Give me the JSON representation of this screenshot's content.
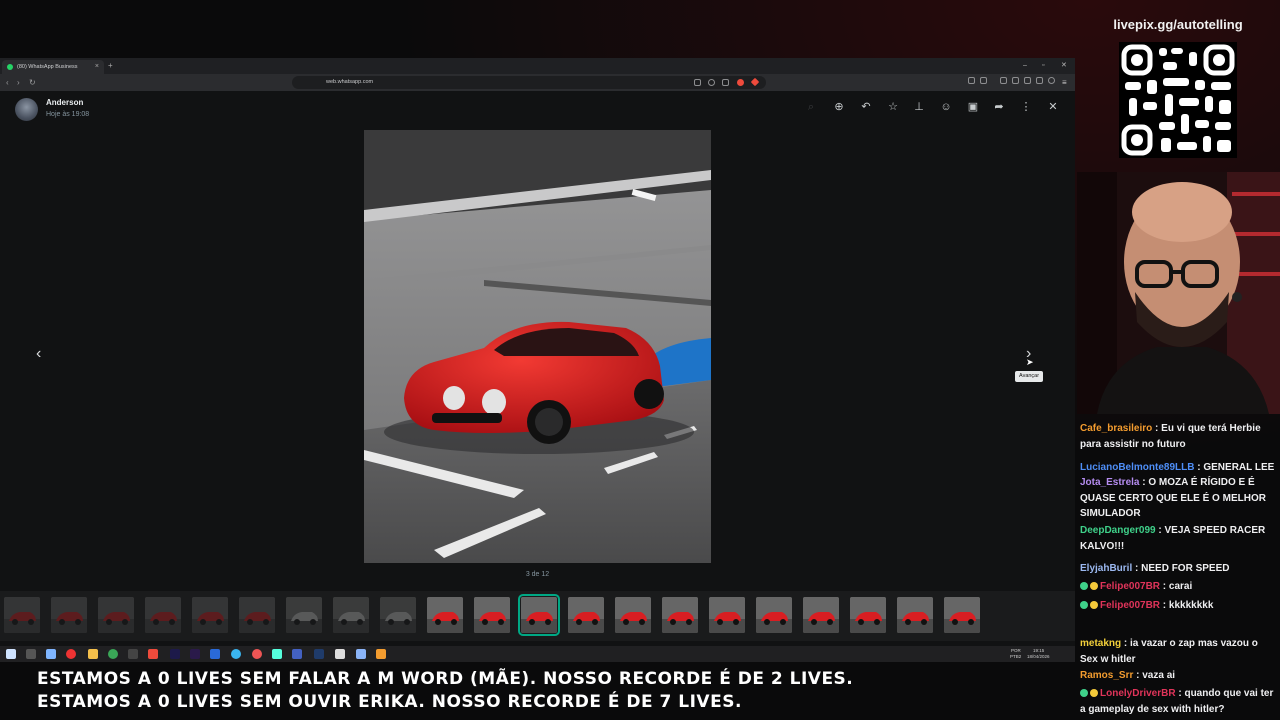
{
  "browser": {
    "tab_title": "(80) WhatsApp Business",
    "url": "web.whatsapp.com"
  },
  "viewer": {
    "sender": "Anderson",
    "time": "Hoje às 19:08",
    "counter": "3 de 12",
    "tooltip": "Avançar",
    "total_thumbnails": 21,
    "selected_thumbnail": 11
  },
  "taskbar": {
    "lang_top": "POR",
    "lang_bottom": "PTB2",
    "clock_time": "19:15",
    "clock_date": "18/04/2026"
  },
  "ticker": {
    "line1": "ESTAMOS A 0 LIVES SEM FALAR A M WORD (MÃE). NOSSO RECORDE É DE 2 LIVES.",
    "line2": "ESTAMOS A 0 LIVES SEM OUVIR ERIKA. NOSSO RECORDE É DE 7 LIVES."
  },
  "stream": {
    "livepix": "livepix.gg/autotelling"
  },
  "chat": {
    "messages": [
      {
        "user": "Cafe_brasileiro",
        "text": " : Eu vi que terá Herbie para assistir no futuro",
        "color": "#f39c2f",
        "badges": false
      },
      {
        "user": "LucianoBelmonte89LLB",
        "text": " : GENERAL LEE",
        "color": "#4e8ef7",
        "badges": false
      },
      {
        "user": "Jota_Estrela",
        "text": " : O MOZA É RÍGIDO E É QUASE CERTO QUE ELE É O MELHOR SIMULADOR",
        "color": "#b58cf0",
        "badges": false
      },
      {
        "user": "DeepDanger099",
        "text": " : VEJA SPEED RACER KALVO!!!",
        "color": "#3fd18a",
        "badges": false
      },
      {
        "user": "ElyjahBuril",
        "text": " : NEED FOR SPEED",
        "color": "#9bb8f0",
        "badges": false
      },
      {
        "user": "Felipe007BR",
        "text": " : carai",
        "color": "#e0345a",
        "badges": true
      },
      {
        "user": "Felipe007BR",
        "text": " : kkkkkkkk",
        "color": "#e0345a",
        "badges": true
      },
      {
        "user": "metakng",
        "text": " : ia vazar o zap mas vazou o Sex w hitler",
        "color": "#f3d03a",
        "badges": false
      },
      {
        "user": "Ramos_Srr",
        "text": " : vaza ai",
        "color": "#f39c2f",
        "badges": false
      },
      {
        "user": "LonelyDriverBR",
        "text": " : quando que vai ter a gameplay de sex with hitler?",
        "color": "#e0345a",
        "badges": true
      }
    ]
  },
  "colors": {
    "accent": "#00a884",
    "car_red": "#d81e22"
  }
}
